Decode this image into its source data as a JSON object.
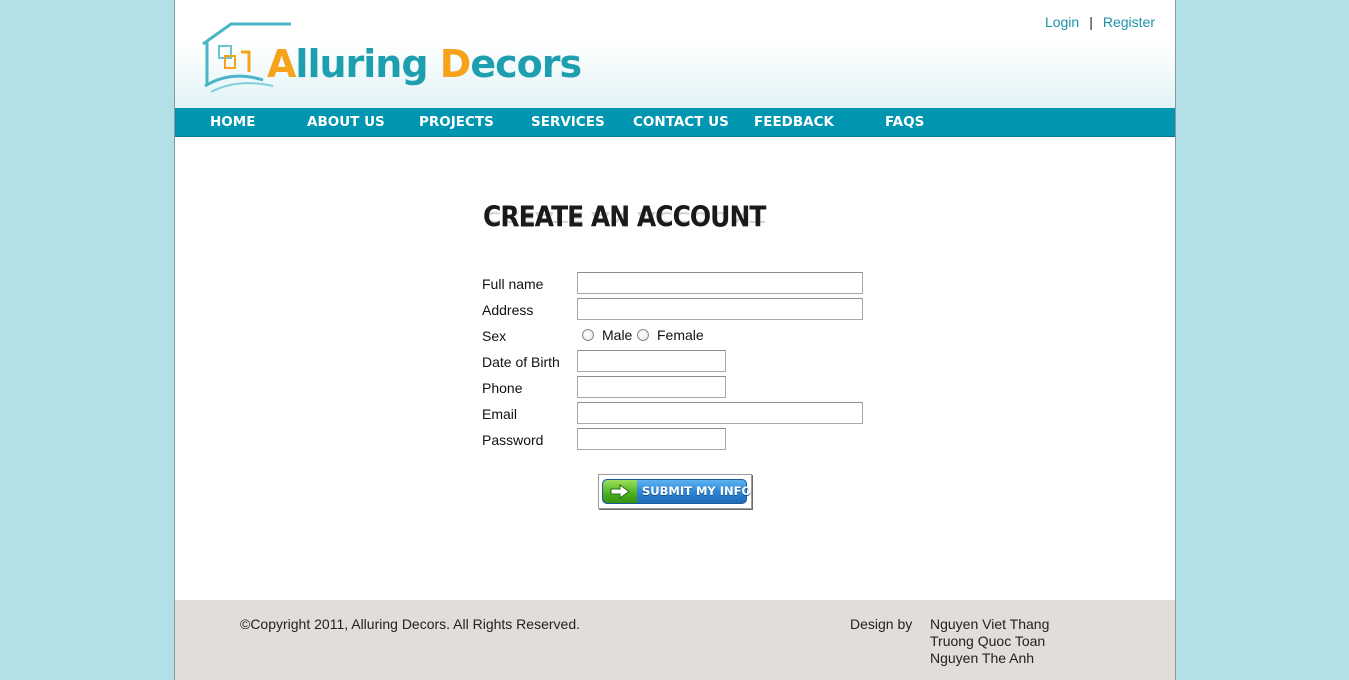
{
  "header": {
    "logo": {
      "part1_accent": "A",
      "part1_rest": "lluring ",
      "part2_accent": "D",
      "part2_rest": "ecors"
    },
    "links": {
      "login": "Login",
      "separator": "|",
      "register": "Register"
    }
  },
  "nav": {
    "items": [
      {
        "label": "HOME"
      },
      {
        "label": "ABOUT US"
      },
      {
        "label": "PROJECTS"
      },
      {
        "label": "SERVICES"
      },
      {
        "label": "CONTACT US"
      },
      {
        "label": "FEEDBACK"
      },
      {
        "label": "FAQS"
      }
    ]
  },
  "form": {
    "title": "CREATE AN ACCOUNT",
    "fields": {
      "full_name": {
        "label": "Full name",
        "value": ""
      },
      "address": {
        "label": "Address",
        "value": ""
      },
      "sex": {
        "label": "Sex",
        "option_male": "Male",
        "option_female": "Female"
      },
      "dob": {
        "label": "Date of Birth",
        "value": ""
      },
      "phone": {
        "label": "Phone",
        "value": ""
      },
      "email": {
        "label": "Email",
        "value": ""
      },
      "password": {
        "label": "Password",
        "value": ""
      }
    },
    "submit_label": "SUBMIT MY INFO"
  },
  "footer": {
    "copyright": "©Copyright 2011, Alluring Decors. All Rights Reserved.",
    "design_by": "Design by",
    "designers": [
      "Nguyen Viet Thang",
      "Truong Quoc Toan",
      "Nguyen The Anh"
    ]
  },
  "colors": {
    "background": "#b2e0e6",
    "nav": "#0096b2",
    "logo_teal": "#1e9fb0",
    "logo_orange": "#f5a31a",
    "footer": "#e0dddb"
  }
}
